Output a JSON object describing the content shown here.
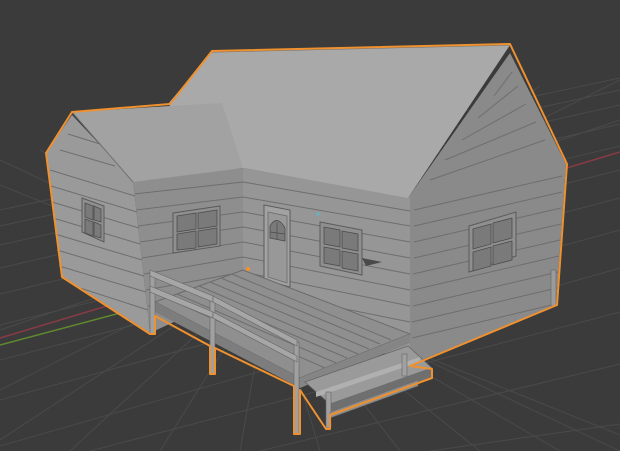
{
  "viewport": {
    "background": "#3b3b3b",
    "grid_color": "#4a4a4a",
    "x_axis_color": "#8a3b45",
    "y_axis_color": "#5f8a2e",
    "selection_outline_color": "#f0912f",
    "object_color": "#8c8c8c"
  }
}
